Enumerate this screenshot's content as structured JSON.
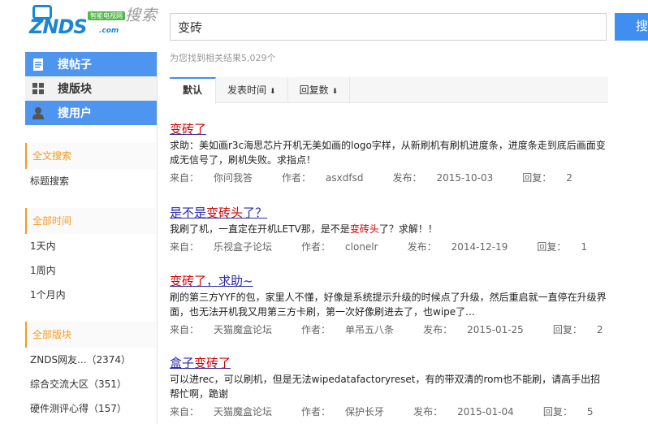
{
  "logo": {
    "sub": "智能电视网",
    "main": "ZNDS",
    "com": ".com"
  },
  "search_title": "搜索",
  "search": {
    "value": "变砖",
    "button_label": "搜"
  },
  "side_nav": [
    {
      "label": "搜帖子",
      "active": true,
      "icon": "document-icon"
    },
    {
      "label": "搜版块",
      "active": false,
      "icon": "grid-icon"
    },
    {
      "label": "搜用户",
      "active": true,
      "icon": "user-icon"
    }
  ],
  "filters": {
    "fulltext": {
      "header": "全文搜索",
      "items": [
        "标题搜索"
      ]
    },
    "time": {
      "header": "全部时间",
      "items": [
        "1天内",
        "1周内",
        "1个月内"
      ]
    },
    "forums": {
      "header": "全部版块",
      "items": [
        "ZNDS网友...（2374）",
        "综合交流大区（351）",
        "硬件测评心得（157）"
      ]
    }
  },
  "result_count": "为您找到相关结果5,029个",
  "tabs": [
    {
      "label": "默认",
      "active": true
    },
    {
      "label": "发表时间",
      "arrow": "⬇"
    },
    {
      "label": "回复数",
      "arrow": "⬇"
    }
  ],
  "results": [
    {
      "title_pre": "",
      "title_hl": "变砖了",
      "title_post": "",
      "snippet": "求助：美如画r3c海思芯片开机无美如画的logo字样，从新刷机有刷机进度条，进度条走到底后画面变成无信号了，刷机失败。求指点！",
      "from_label": "来自：",
      "from": "你问我答",
      "author_label": "作者：",
      "author": "asxdfsd",
      "date_label": "发布：",
      "date": "2015-10-03",
      "reply_label": "回复：",
      "replies": "2"
    },
    {
      "title_pre": "是不是",
      "title_hl": "变砖头",
      "title_post": "了？",
      "snippet_pre": "我刷了机，一直定在开机LETV那，是不是",
      "snippet_hl": "变砖头",
      "snippet_post": "了？求解！！",
      "from_label": "来自：",
      "from": "乐视盒子论坛",
      "author_label": "作者：",
      "author": "clonelr",
      "date_label": "发布：",
      "date": "2014-12-19",
      "reply_label": "回复：",
      "replies": "1"
    },
    {
      "title_pre": "",
      "title_hl": "变砖了",
      "title_post": "，求助~",
      "snippet": "刷的第三方YYF的包，家里人不懂，好像是系统提示升级的时候点了升级，然后重启就一直停在升级界面，也无法开机我又用第三方卡刷，第一次好像刷进去了，也wipe了...",
      "from_label": "来自：",
      "from": "天猫魔盒论坛",
      "author_label": "作者：",
      "author": "单吊五八条",
      "date_label": "发布：",
      "date": "2015-01-25",
      "reply_label": "回复：",
      "replies": "2"
    },
    {
      "title_pre": "盒子",
      "title_hl": "变砖了",
      "title_post": "",
      "snippet": "可以进rec，可以刷机，但是无法wipedatafactoryreset，有的带双清的rom也不能刷，请高手出招帮忙啊，跪谢",
      "from_label": "来自：",
      "from": "天猫魔盒论坛",
      "author_label": "作者：",
      "author": "保护长牙",
      "date_label": "发布：",
      "date": "2015-01-04",
      "reply_label": "回复：",
      "replies": "5"
    }
  ],
  "colors": {
    "accent": "#3f8ef0",
    "nav_active": "#4e95f0",
    "filter_accent": "#f39c1f",
    "highlight": "#d20000",
    "link": "#2a2aa8"
  }
}
